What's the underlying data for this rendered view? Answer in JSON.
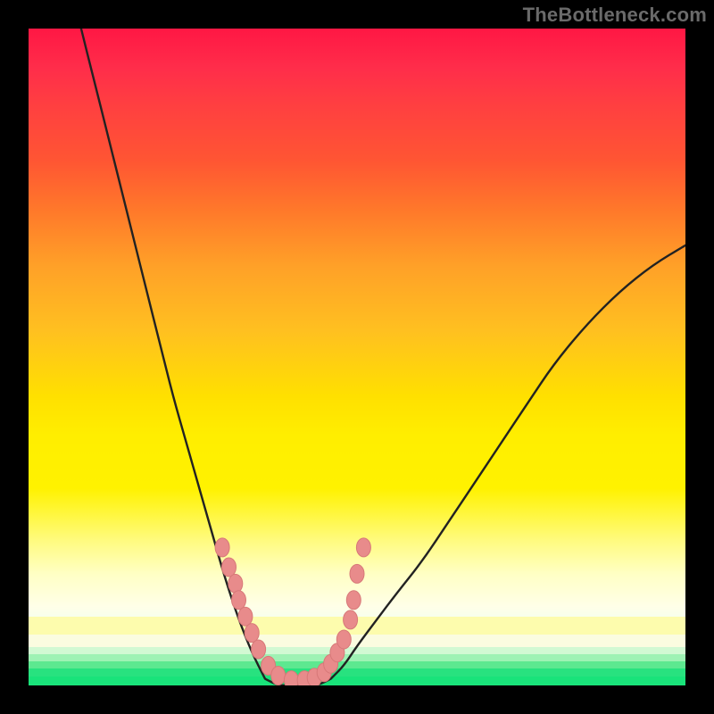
{
  "watermark": "TheBottleneck.com",
  "colors": {
    "curve": "#222222",
    "dot_fill": "#e88b8b",
    "dot_stroke": "#d77878"
  },
  "chart_data": {
    "type": "line",
    "title": "",
    "xlabel": "",
    "ylabel": "",
    "xlim": [
      0,
      100
    ],
    "ylim": [
      0,
      100
    ],
    "series": [
      {
        "name": "curve-left",
        "x": [
          8,
          10,
          12,
          14,
          16,
          18,
          20,
          22,
          24,
          26,
          28,
          30,
          32,
          34,
          36
        ],
        "y": [
          100,
          92,
          84,
          76,
          68,
          60,
          52,
          44,
          37,
          30,
          23,
          16,
          10,
          5,
          1
        ]
      },
      {
        "name": "valley",
        "x": [
          36,
          38,
          40,
          42,
          44,
          46
        ],
        "y": [
          1,
          0,
          0,
          0,
          0,
          1
        ]
      },
      {
        "name": "curve-right",
        "x": [
          46,
          48,
          50,
          53,
          56,
          60,
          64,
          68,
          72,
          76,
          80,
          85,
          90,
          95,
          100
        ],
        "y": [
          1,
          3,
          6,
          10,
          14,
          19,
          25,
          31,
          37,
          43,
          49,
          55,
          60,
          64,
          67
        ]
      }
    ],
    "dots": {
      "name": "markers",
      "x": [
        29.5,
        30.5,
        31.5,
        32.0,
        33.0,
        34.0,
        35.0,
        36.5,
        38.0,
        40.0,
        42.0,
        43.5,
        45.0,
        46.0,
        47.0,
        48.0,
        49.0,
        49.5,
        50.0,
        51.0
      ],
      "y": [
        21.0,
        18.0,
        15.5,
        13.0,
        10.5,
        8.0,
        5.5,
        3.0,
        1.5,
        0.8,
        0.8,
        1.2,
        2.0,
        3.3,
        5.0,
        7.0,
        10.0,
        13.0,
        17.0,
        21.0
      ]
    }
  }
}
